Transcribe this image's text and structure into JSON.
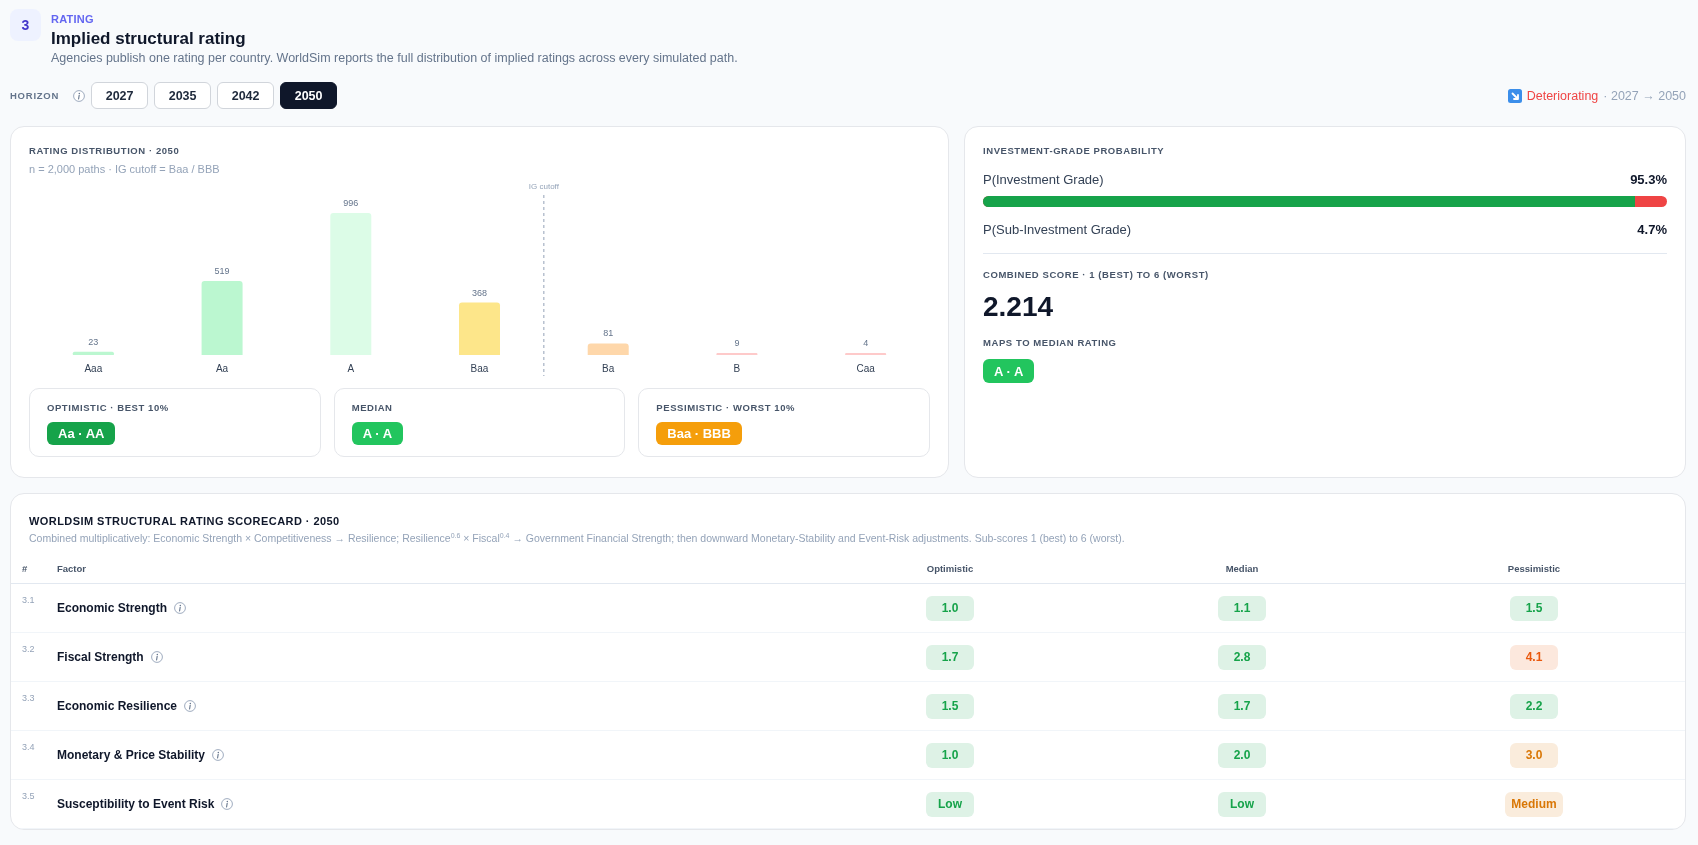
{
  "section": {
    "number": "3",
    "eyebrow": "RATING",
    "title": "Implied structural rating",
    "description": "Agencies publish one rating per country. WorldSim reports the full distribution of implied ratings across every simulated path."
  },
  "horizon": {
    "label": "HORIZON",
    "tabs": [
      {
        "label": "2027",
        "selected": false
      },
      {
        "label": "2035",
        "selected": false
      },
      {
        "label": "2042",
        "selected": false
      },
      {
        "label": "2050",
        "selected": true
      }
    ]
  },
  "trend": {
    "deteriorating": true,
    "label": "Deteriorating",
    "period": "· 2027 → 2050"
  },
  "distribution": {
    "title": "RATING DISTRIBUTION · 2050",
    "subtitle": "n = 2,000 paths · IG cutoff = Baa / BBB",
    "cutoff_label": "IG cutoff",
    "bars": [
      {
        "color": "#bbf7d0"
      },
      {
        "color": "#bbf7d0"
      },
      {
        "color": "#dcfce7"
      },
      {
        "color": "#fde68a"
      },
      {
        "color": "#fed7aa"
      },
      {
        "color": "#fecaca"
      },
      {
        "color": "#fecaca"
      }
    ],
    "chart_data": {
      "type": "bar",
      "categories": [
        "Aaa",
        "Aa",
        "A",
        "Baa",
        "Ba",
        "B",
        "Caa"
      ],
      "values": [
        23,
        519,
        996,
        368,
        81,
        9,
        4
      ],
      "data_labels": true
    },
    "scenarios": [
      {
        "label": "OPTIMISTIC · BEST 10%",
        "rating": "Aa · AA",
        "color": "#16a34a"
      },
      {
        "label": "MEDIAN",
        "rating": "A · A",
        "color": "#22c55e"
      },
      {
        "label": "PESSIMISTIC · WORST 10%",
        "rating": "Baa · BBB",
        "color": "#f59e0b"
      }
    ]
  },
  "probability": {
    "title": "INVESTMENT-GRADE PROBABILITY",
    "investment_grade": {
      "label": "P(Investment Grade)",
      "value": "95.3%"
    },
    "meter": {
      "level": 0.953
    },
    "sub_investment_grade": {
      "label": "P(Sub-Investment Grade)",
      "value": "4.7%"
    },
    "score_label": "COMBINED SCORE · 1 (BEST) TO 6 (WORST)",
    "score": "2.214",
    "median_label": "MAPS TO MEDIAN RATING",
    "median_rating": {
      "text": "A · A",
      "color": "#22c55e"
    }
  },
  "scorecard": {
    "title": "WORLDSIM STRUCTURAL RATING SCORECARD · 2050",
    "note": "Combined multiplicatively: Economic Strength × Competitiveness → Resilience; Resilience$^{0.6}$ × Fiscal$^{0.4}$ → Government Financial Strength; then downward Monetary-Stability and Event-Risk adjustments. Sub-scores 1 (best) to 6 (worst).",
    "columns": [
      "#",
      "Factor",
      "Optimistic",
      "Median",
      "Pessimistic"
    ],
    "rows": [
      {
        "number": "3.1",
        "factor": "Economic Strength",
        "optimistic": {
          "value": "1.0",
          "color": "#16a34a"
        },
        "median": {
          "value": "1.1",
          "color": "#16a34a"
        },
        "pessimistic": {
          "value": "1.5",
          "color": "#16a34a"
        }
      },
      {
        "number": "3.2",
        "factor": "Fiscal Strength",
        "optimistic": {
          "value": "1.7",
          "color": "#16a34a"
        },
        "median": {
          "value": "2.8",
          "color": "#16a34a"
        },
        "pessimistic": {
          "value": "4.1",
          "color": "#ea580c"
        }
      },
      {
        "number": "3.3",
        "factor": "Economic Resilience",
        "optimistic": {
          "value": "1.5",
          "color": "#16a34a"
        },
        "median": {
          "value": "1.7",
          "color": "#16a34a"
        },
        "pessimistic": {
          "value": "2.2",
          "color": "#16a34a"
        }
      },
      {
        "number": "3.4",
        "factor": "Monetary & Price Stability",
        "optimistic": {
          "value": "1.0",
          "color": "#16a34a"
        },
        "median": {
          "value": "2.0",
          "color": "#16a34a"
        },
        "pessimistic": {
          "value": "3.0",
          "color": "#d97706"
        }
      },
      {
        "number": "3.5",
        "factor": "Susceptibility to Event Risk",
        "optimistic": {
          "value": "Low",
          "color": "#16a34a"
        },
        "median": {
          "value": "Low",
          "color": "#16a34a"
        },
        "pessimistic": {
          "value": "Medium",
          "color": "#d97706"
        }
      }
    ]
  }
}
